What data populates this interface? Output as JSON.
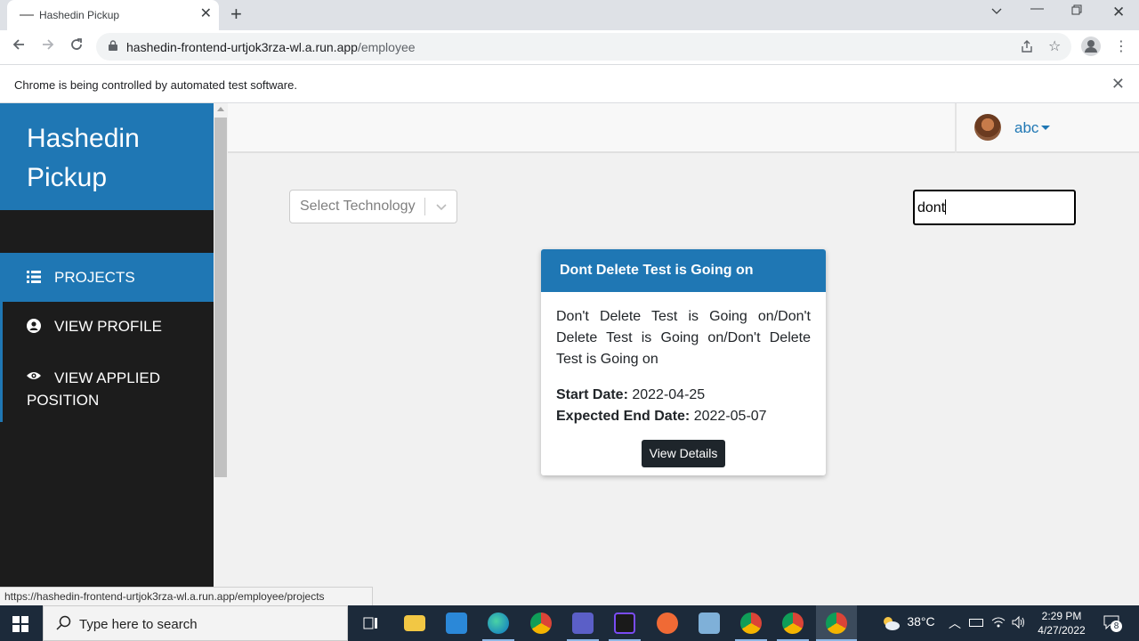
{
  "browser": {
    "tab_title": "Hashedin Pickup",
    "url_host": "hashedin-frontend-urtjok3rza-wl.a.run.app",
    "url_path": "/employee",
    "infobar_message": "Chrome is being controlled by automated test software.",
    "status_url": "https://hashedin-frontend-urtjok3rza-wl.a.run.app/employee/projects"
  },
  "sidebar": {
    "brand": "Hashedin Pickup",
    "items": [
      {
        "label": "PROJECTS",
        "icon": "list-icon",
        "active": true
      },
      {
        "label": "VIEW PROFILE",
        "icon": "user-circle-icon",
        "active": false
      },
      {
        "label": "VIEW APPLIED POSITION",
        "icon": "eye-icon",
        "active": false
      }
    ]
  },
  "header": {
    "user_name": "abc"
  },
  "filters": {
    "technology_placeholder": "Select Technology",
    "search_value": "dont"
  },
  "project_card": {
    "title": "Dont Delete Test is Going on",
    "description": "Don't Delete Test is Going on/Don't Delete Test is Going on/Don't Delete Test is Going on",
    "start_date_label": "Start Date:",
    "start_date": "2022-04-25",
    "end_date_label": "Expected End Date:",
    "end_date": "2022-05-07",
    "button_label": "View Details"
  },
  "taskbar": {
    "search_placeholder": "Type here to search",
    "weather": "38°C",
    "time": "2:29 PM",
    "date": "4/27/2022",
    "notification_count": "8"
  },
  "colors": {
    "brand_blue": "#1f77b4",
    "sidebar_dark": "#1c1c1c",
    "button_dark": "#1e252b"
  }
}
